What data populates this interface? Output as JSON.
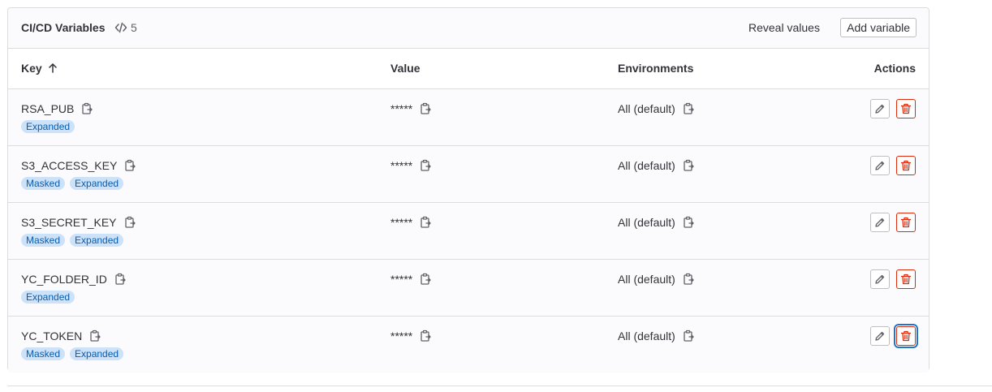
{
  "header": {
    "title": "CI/CD Variables",
    "count": "5",
    "reveal_label": "Reveal values",
    "add_label": "Add variable"
  },
  "columns": {
    "key": "Key",
    "value": "Value",
    "environments": "Environments",
    "actions": "Actions"
  },
  "variables": [
    {
      "key": "RSA_PUB",
      "value": "*****",
      "env": "All (default)",
      "badges": [
        "Expanded"
      ]
    },
    {
      "key": "S3_ACCESS_KEY",
      "value": "*****",
      "env": "All (default)",
      "badges": [
        "Masked",
        "Expanded"
      ]
    },
    {
      "key": "S3_SECRET_KEY",
      "value": "*****",
      "env": "All (default)",
      "badges": [
        "Masked",
        "Expanded"
      ]
    },
    {
      "key": "YC_FOLDER_ID",
      "value": "*****",
      "env": "All (default)",
      "badges": [
        "Expanded"
      ]
    },
    {
      "key": "YC_TOKEN",
      "value": "*****",
      "env": "All (default)",
      "badges": [
        "Masked",
        "Expanded"
      ]
    }
  ],
  "icons": {
    "count": "code-icon",
    "sort": "arrow-up-icon",
    "copy": "copy-icon",
    "edit": "pencil-icon",
    "delete": "trash-icon"
  },
  "colors": {
    "badge_bg": "#cbe2f9",
    "badge_text": "#0b5cad",
    "danger": "#dd2b0e",
    "focus": "#1f75cb"
  }
}
